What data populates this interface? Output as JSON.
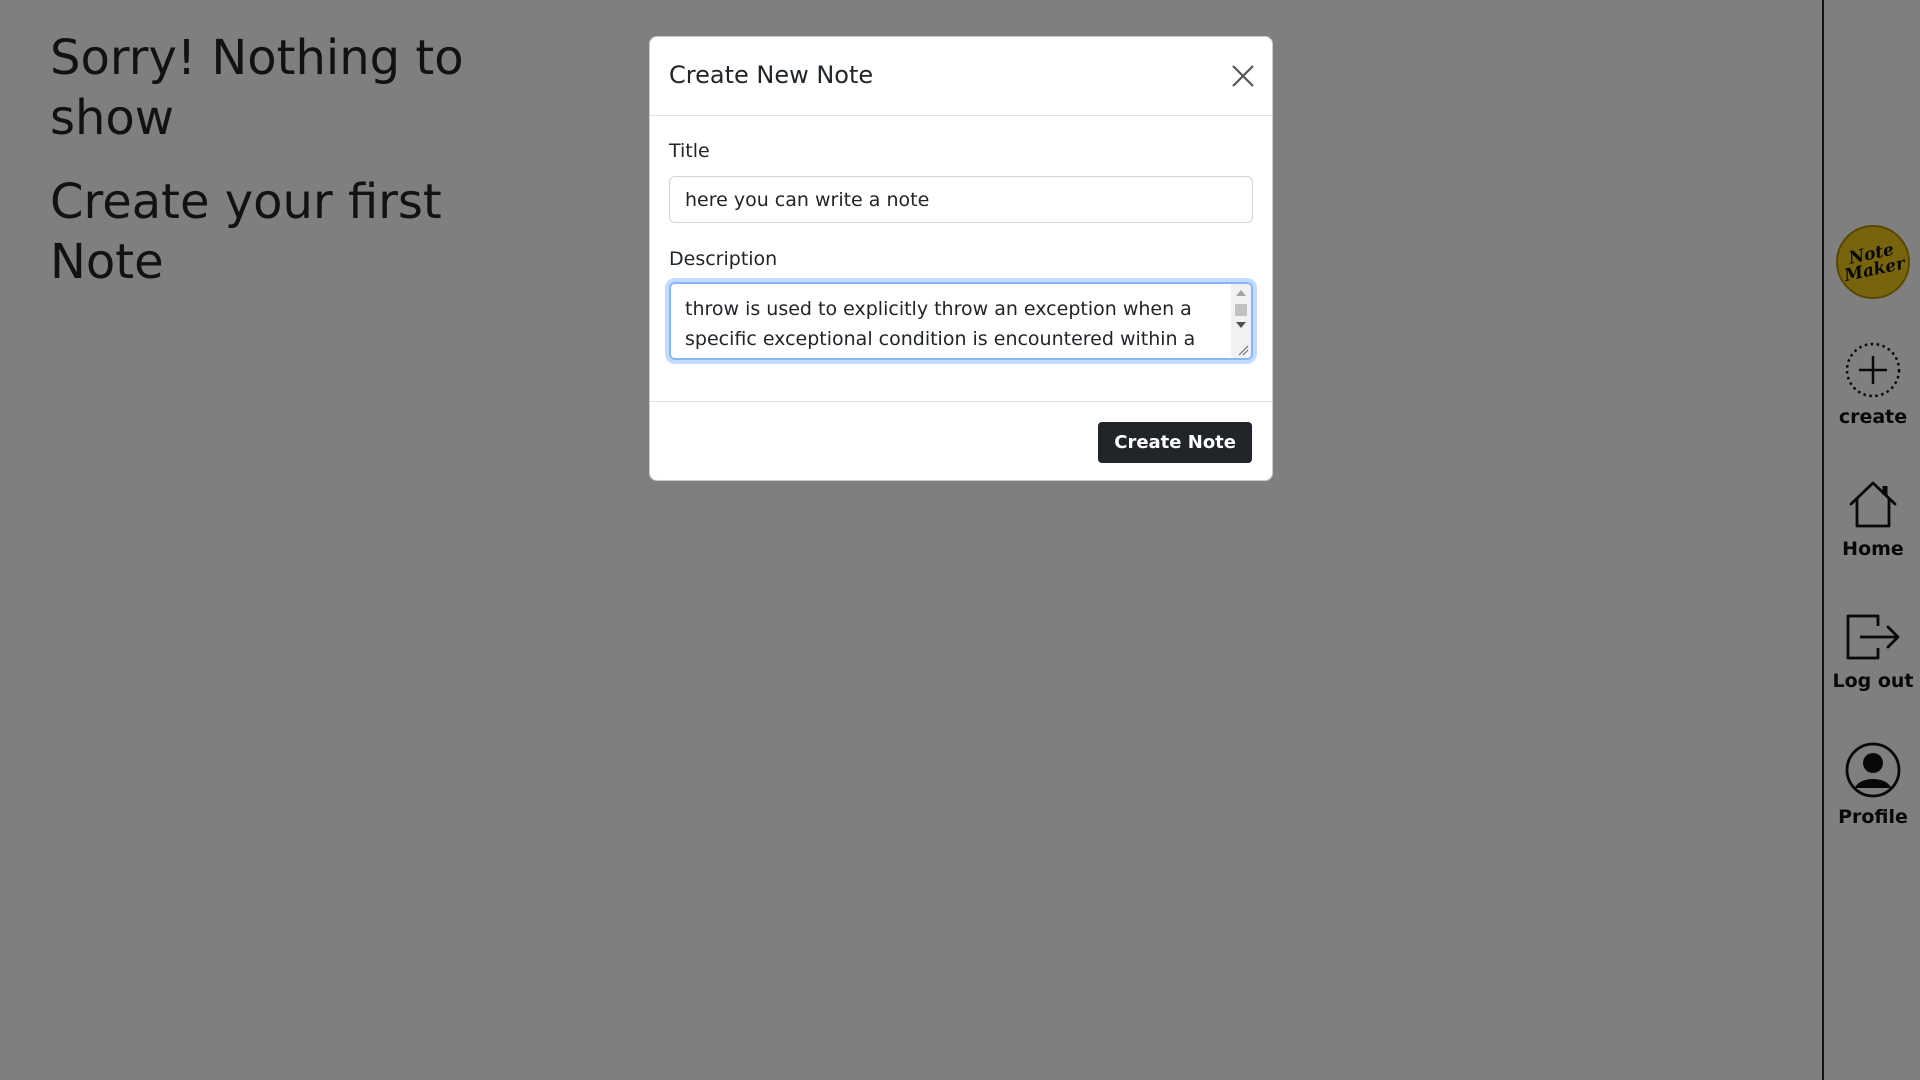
{
  "empty_state": {
    "line1": "Sorry! Nothing to show",
    "line2": "Create your first Note"
  },
  "sidebar": {
    "logo_text": "Note Maker",
    "items": [
      {
        "label": "create",
        "icon": "plus-circle-dotted-icon"
      },
      {
        "label": "Home",
        "icon": "house-icon"
      },
      {
        "label": "Log out",
        "icon": "box-arrow-right-icon"
      },
      {
        "label": "Profile",
        "icon": "person-circle-icon"
      }
    ]
  },
  "modal": {
    "title": "Create New Note",
    "title_field": {
      "label": "Title",
      "value": "here you can write a note"
    },
    "description_field": {
      "label": "Description",
      "value": "throw is used to explicitly throw an exception when a specific exceptional condition is encountered within a"
    },
    "submit_label": "Create Note"
  },
  "colors": {
    "backdrop": "#808080",
    "logo_fill": "#f3c81c",
    "button_bg": "#212529",
    "focus_ring": "#86b7fe"
  }
}
